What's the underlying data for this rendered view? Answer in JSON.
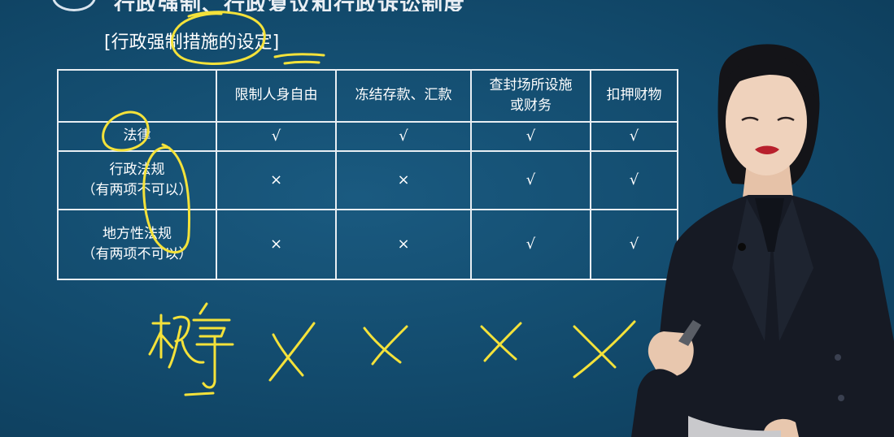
{
  "header": {
    "title": "行政强制、行政复议和行政诉讼制度"
  },
  "section_title": "[行政强制措施的设定]",
  "table": {
    "headers": [
      "",
      "限制人身自由",
      "冻结存款、汇款",
      "查封场所设施\n或财务",
      "扣押财物"
    ],
    "rows": [
      {
        "label": "法律",
        "sublabel": "",
        "marks": [
          "√",
          "√",
          "√",
          "√"
        ]
      },
      {
        "label": "行政法规",
        "sublabel": "（有两项不可以）",
        "marks": [
          "×",
          "×",
          "√",
          "√"
        ]
      },
      {
        "label": "地方性法规",
        "sublabel": "（有两项不可以）",
        "marks": [
          "×",
          "×",
          "√",
          "√"
        ]
      }
    ]
  },
  "handwriting": {
    "row_label": "规章"
  },
  "colors": {
    "background": "#124a6c",
    "grid_line": "#e8eef3",
    "annotation_ink": "#f4e23a"
  }
}
